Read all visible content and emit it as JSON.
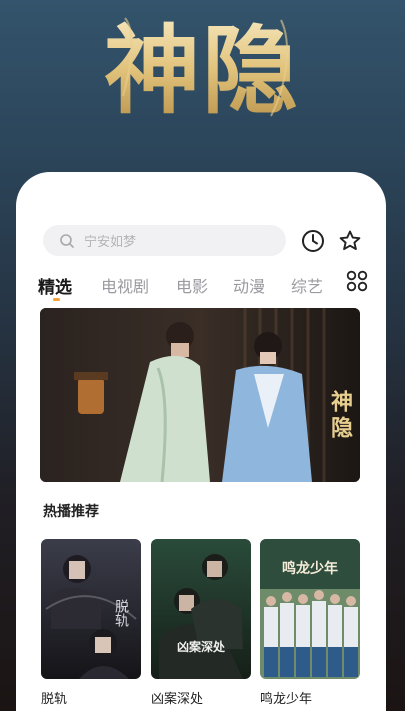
{
  "hero": {
    "logo_text": "神隐"
  },
  "search": {
    "placeholder": "宁安如梦",
    "icon": "search-icon"
  },
  "header_actions": {
    "history_icon": "clock-icon",
    "favorites_icon": "star-icon"
  },
  "tabs": [
    {
      "label": "精选",
      "active": true
    },
    {
      "label": "电视剧",
      "active": false
    },
    {
      "label": "电影",
      "active": false
    },
    {
      "label": "动漫",
      "active": false
    },
    {
      "label": "综艺",
      "active": false
    }
  ],
  "more_categories_icon": "grid-icon",
  "accent_color": "#f2a23a",
  "banner": {
    "title_text": "神隐"
  },
  "hot": {
    "title": "热播推荐",
    "items": [
      {
        "title": "脱轨",
        "poster_text": "脱轨"
      },
      {
        "title": "凶案深处",
        "poster_text": "凶案深处"
      },
      {
        "title": "鸣龙少年",
        "poster_text": "鸣龙少年"
      }
    ]
  }
}
